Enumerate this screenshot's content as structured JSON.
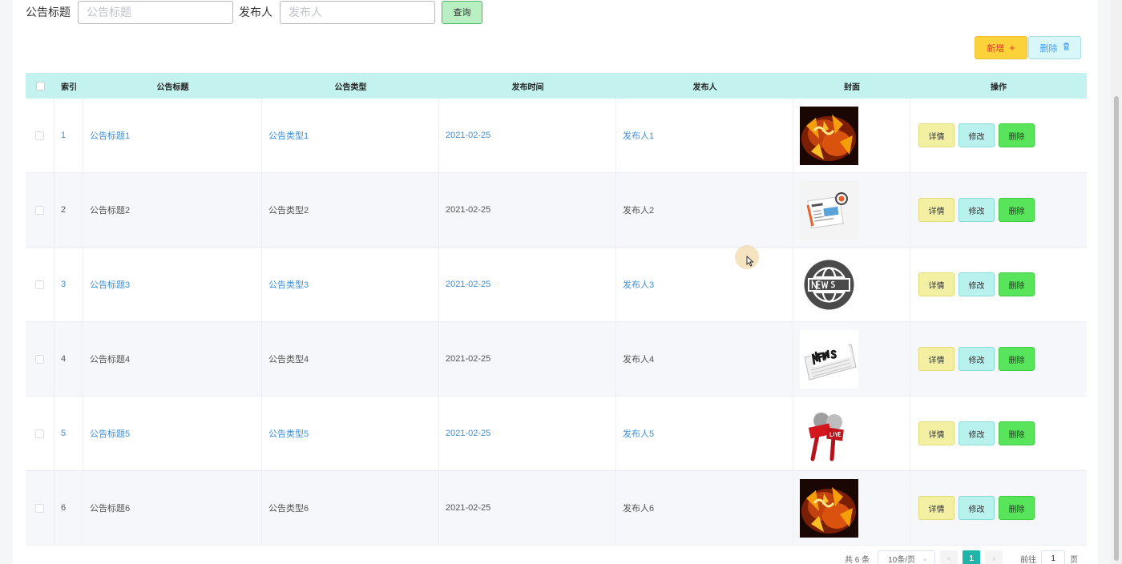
{
  "search": {
    "title_label": "公告标题",
    "title_placeholder": "公告标题",
    "title_value": "",
    "publisher_label": "发布人",
    "publisher_placeholder": "发布人",
    "publisher_value": "",
    "query_label": "查询"
  },
  "actions": {
    "add_label": "新增",
    "delete_label": "删除"
  },
  "table": {
    "columns": [
      "索引",
      "公告标题",
      "公告类型",
      "发布时间",
      "发布人",
      "封面",
      "操作"
    ],
    "rows": [
      {
        "index": "1",
        "title": "公告标题1",
        "type": "公告类型1",
        "time": "2021-02-25",
        "publisher": "发布人1",
        "cover": "fire-money-image"
      },
      {
        "index": "2",
        "title": "公告标题2",
        "type": "公告类型2",
        "time": "2021-02-25",
        "publisher": "发布人2",
        "cover": "newspaper-icon-image"
      },
      {
        "index": "3",
        "title": "公告标题3",
        "type": "公告类型3",
        "time": "2021-02-25",
        "publisher": "发布人3",
        "cover": "news-globe-image"
      },
      {
        "index": "4",
        "title": "公告标题4",
        "type": "公告类型4",
        "time": "2021-02-25",
        "publisher": "发布人4",
        "cover": "news-paper-image"
      },
      {
        "index": "5",
        "title": "公告标题5",
        "type": "公告类型5",
        "time": "2021-02-25",
        "publisher": "发布人5",
        "cover": "live-microphone-image"
      },
      {
        "index": "6",
        "title": "公告标题6",
        "type": "公告类型6",
        "time": "2021-02-25",
        "publisher": "发布人6",
        "cover": "fire-money-image"
      }
    ],
    "ops": {
      "detail": "详情",
      "edit": "修改",
      "delete": "删除"
    }
  },
  "pagination": {
    "total": "共 6 条",
    "page_size": "10条/页",
    "current_page": "1",
    "goto_label": "前往",
    "goto_value": "1",
    "page_unit": "页"
  },
  "colors": {
    "header_bg": "#c4f3ef",
    "add_button": "#fbd23a",
    "delete_button": "#d9f6f9",
    "query_button": "#b8f0c1",
    "detail_button": "#f3f0a4",
    "edit_button": "#b8f1ee",
    "row_delete_button": "#58e55b",
    "link_text": "#3e8fd8",
    "current_page": "#1fb5a9"
  }
}
